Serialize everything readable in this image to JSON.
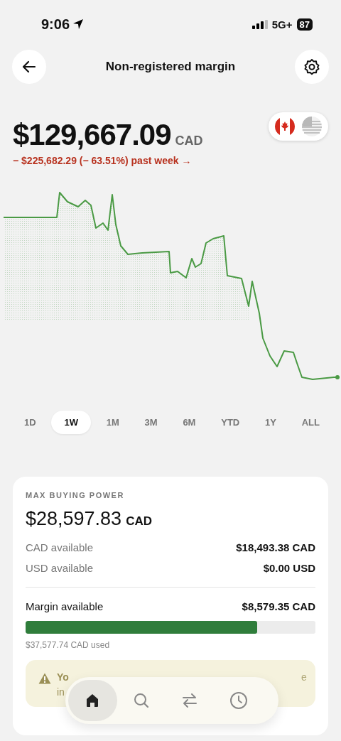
{
  "status_bar": {
    "time": "9:06",
    "network": "5G+",
    "battery": "87"
  },
  "header": {
    "title": "Non-registered margin"
  },
  "balance": {
    "amount": "$129,667.09",
    "currency": "CAD",
    "change": "− $225,682.29 (− 63.51%) past week →"
  },
  "currencies": [
    {
      "kind": "ca",
      "selected": true
    },
    {
      "kind": "us",
      "selected": false
    }
  ],
  "periods": [
    {
      "label": "1D",
      "selected": false
    },
    {
      "label": "1W",
      "selected": true
    },
    {
      "label": "1M",
      "selected": false
    },
    {
      "label": "3M",
      "selected": false
    },
    {
      "label": "6M",
      "selected": false
    },
    {
      "label": "YTD",
      "selected": false
    },
    {
      "label": "1Y",
      "selected": false
    },
    {
      "label": "ALL",
      "selected": false
    }
  ],
  "buying_power": {
    "title": "MAX BUYING POWER",
    "amount": "$28,597.83",
    "currency": "CAD",
    "rows": [
      {
        "label": "CAD available",
        "value": "$18,493.38 CAD"
      },
      {
        "label": "USD available",
        "value": "$0.00 USD"
      }
    ],
    "margin": {
      "label": "Margin available",
      "value": "$8,579.35 CAD",
      "level": 0.8,
      "used": "$37,577.74 CAD used"
    }
  },
  "warning": {
    "line_1_start": "Yo",
    "line_1_end": "e",
    "line_2_start": "in"
  },
  "nav": [
    {
      "kind": "home",
      "selected": true
    },
    {
      "kind": "search",
      "selected": false
    },
    {
      "kind": "transfer",
      "selected": false
    },
    {
      "kind": "activity",
      "selected": false
    }
  ]
}
